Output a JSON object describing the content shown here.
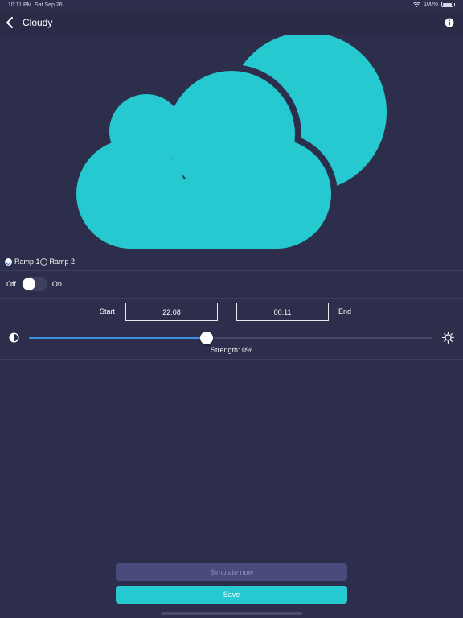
{
  "status_bar": {
    "time": "10:11 PM",
    "date": "Sat Sep 26",
    "battery": "100%"
  },
  "nav": {
    "title": "Cloudy",
    "back_icon": "chevron-left-icon",
    "info_icon": "info-icon"
  },
  "hero": {
    "icon": "cloud-moon-icon",
    "color": "#26c9cf"
  },
  "ramp": {
    "options": [
      {
        "label": "Ramp 1",
        "checked": true
      },
      {
        "label": "Ramp 2",
        "checked": false
      }
    ]
  },
  "toggle": {
    "off_label": "Off",
    "on_label": "On",
    "state": false
  },
  "schedule": {
    "start_label": "Start",
    "start_value": "22:08",
    "end_value": "00:11",
    "end_label": "End"
  },
  "strength": {
    "label": "Strength: 0%",
    "slider_fraction": 0.44,
    "left_icon": "contrast-icon",
    "right_icon": "brightness-icon"
  },
  "actions": {
    "simulate_label": "Simulate now",
    "save_label": "Save"
  },
  "colors": {
    "background": "#2c2e4b",
    "accent": "#26c9cf",
    "slider": "#3e8ee8",
    "simulate_button": "#4a4b7c"
  }
}
